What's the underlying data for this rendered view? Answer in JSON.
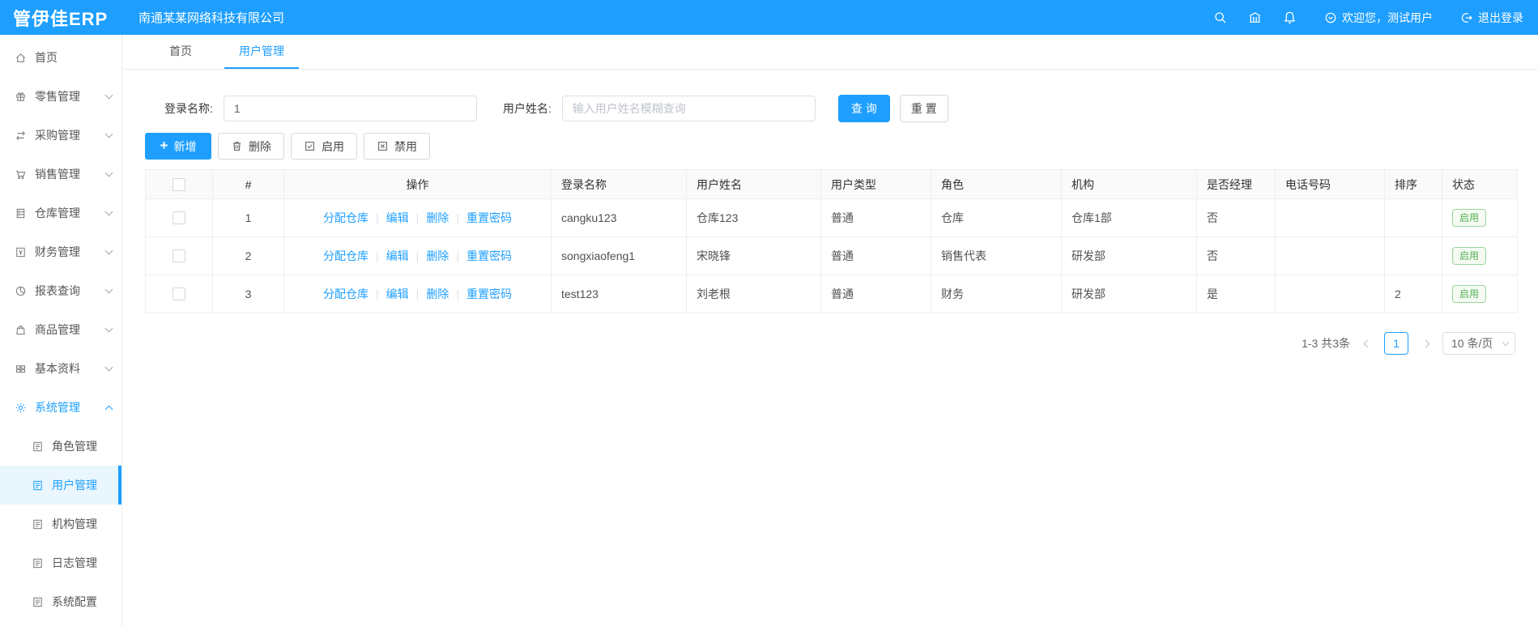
{
  "colors": {
    "accent": "#1E9FFF",
    "status_green": "#53b155",
    "header_bg": "#1E9FFF"
  },
  "header": {
    "logo": "管伊佳ERP",
    "company": "南通某某网络科技有限公司",
    "icons": [
      "search-icon",
      "bank-icon",
      "bell-icon"
    ],
    "welcome": "欢迎您，测试用户",
    "logout": "退出登录"
  },
  "sidebar": {
    "items": [
      {
        "label": "首页",
        "icon": "home-icon",
        "expandable": false
      },
      {
        "label": "零售管理",
        "icon": "retail-icon",
        "expandable": true
      },
      {
        "label": "采购管理",
        "icon": "purchase-icon",
        "expandable": true
      },
      {
        "label": "销售管理",
        "icon": "sales-cart-icon",
        "expandable": true
      },
      {
        "label": "仓库管理",
        "icon": "warehouse-icon",
        "expandable": true
      },
      {
        "label": "财务管理",
        "icon": "finance-icon",
        "expandable": true
      },
      {
        "label": "报表查询",
        "icon": "report-pie-icon",
        "expandable": true
      },
      {
        "label": "商品管理",
        "icon": "goods-bag-icon",
        "expandable": true
      },
      {
        "label": "基本资料",
        "icon": "basic-grid-icon",
        "expandable": true
      },
      {
        "label": "系统管理",
        "icon": "gear-icon",
        "expandable": true,
        "expanded": true,
        "active": true
      }
    ],
    "subitems": [
      "角色管理",
      "用户管理",
      "机构管理",
      "日志管理",
      "系统配置"
    ],
    "active_subitem": "用户管理"
  },
  "tabs": [
    {
      "label": "首页",
      "active": false
    },
    {
      "label": "用户管理",
      "active": true
    }
  ],
  "filter": {
    "login_label": "登录名称:",
    "login_value": "1",
    "name_label": "用户姓名:",
    "name_placeholder": "输入用户姓名模糊查询",
    "search_button": "查 询",
    "reset_button": "重 置"
  },
  "toolbar": {
    "add": "新增",
    "delete": "删除",
    "enable": "启用",
    "disable": "禁用"
  },
  "table": {
    "headers": [
      "#",
      "操作",
      "登录名称",
      "用户姓名",
      "用户类型",
      "角色",
      "机构",
      "是否经理",
      "电话号码",
      "排序",
      "状态"
    ],
    "op_links": [
      "分配仓库",
      "编辑",
      "删除",
      "重置密码"
    ],
    "rows": [
      {
        "index": "1",
        "login": "cangku123",
        "name": "仓库123",
        "type": "普通",
        "role": "仓库",
        "org": "仓库1部",
        "manager": "否",
        "phone": "",
        "sort": "",
        "status": "启用"
      },
      {
        "index": "2",
        "login": "songxiaofeng1",
        "name": "宋晓锋",
        "type": "普通",
        "role": "销售代表",
        "org": "研发部",
        "manager": "否",
        "phone": "",
        "sort": "",
        "status": "启用"
      },
      {
        "index": "3",
        "login": "test123",
        "name": "刘老根",
        "type": "普通",
        "role": "财务",
        "org": "研发部",
        "manager": "是",
        "phone": "",
        "sort": "2",
        "status": "启用"
      }
    ]
  },
  "pagination": {
    "total": "1-3 共3条",
    "current_page": "1",
    "page_size": "10 条/页"
  }
}
